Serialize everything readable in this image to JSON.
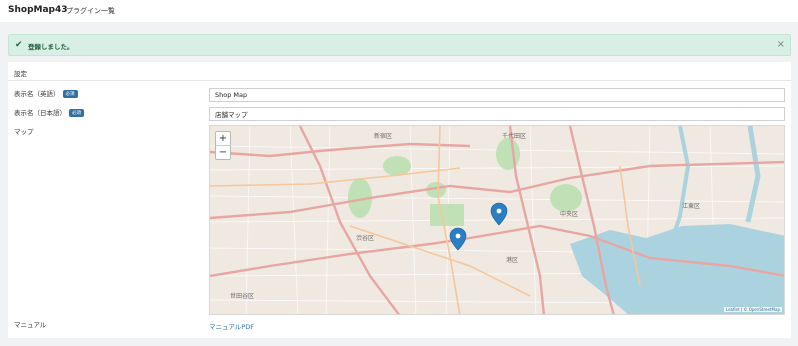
{
  "header": {
    "app_title": "ShopMap43",
    "page_subtitle": "プラグイン一覧"
  },
  "alert": {
    "message": "登録しました。",
    "close": "×"
  },
  "form": {
    "section_title": "設定",
    "fields": [
      {
        "label": "表示名（英語）",
        "badge": "必須",
        "value": "Shop Map"
      },
      {
        "label": "表示名（日本語）",
        "badge": "必須",
        "value": "店舗マップ"
      }
    ],
    "map_label": "マップ",
    "manual_label": "マニュアル",
    "manual_link": "マニュアルPDF"
  },
  "map": {
    "zoom_in": "+",
    "zoom_out": "−",
    "area_labels": [
      "新宿区",
      "千代田区",
      "渋谷区",
      "港区",
      "江東区",
      "中央区",
      "世田谷区"
    ],
    "attribution_leaflet": "Leaflet",
    "attribution_osm": "© OpenStreetMap",
    "marker_color": "#2a7fc4"
  }
}
